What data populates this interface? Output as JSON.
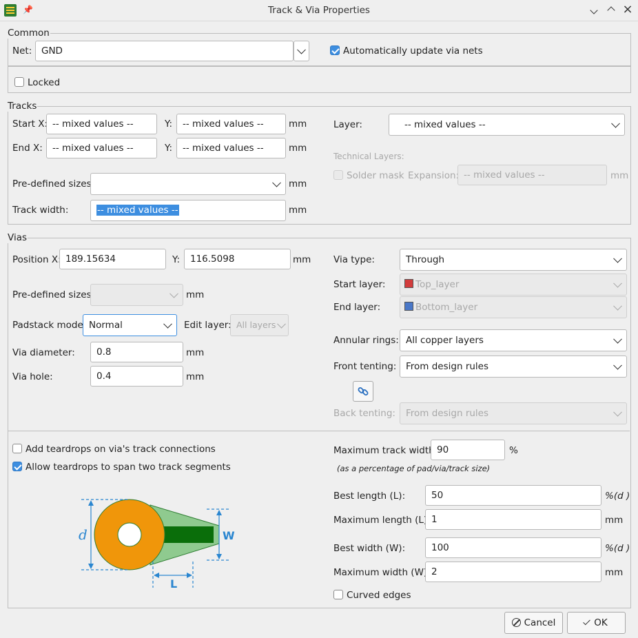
{
  "window": {
    "title": "Track & Via Properties"
  },
  "common": {
    "label": "Common",
    "net_label": "Net:",
    "net_value": "GND",
    "auto_update_label": "Automatically update via nets",
    "locked_label": "Locked"
  },
  "tracks": {
    "label": "Tracks",
    "start_x_label": "Start X:",
    "start_x_value": "-- mixed values --",
    "start_y_label": "Y:",
    "start_y_value": "-- mixed values --",
    "end_x_label": "End X:",
    "end_x_value": "-- mixed values --",
    "end_y_label": "Y:",
    "end_y_value": "-- mixed values --",
    "unit": "mm",
    "layer_label": "Layer:",
    "layer_value": "-- mixed values --",
    "technical_layers_label": "Technical Layers:",
    "solder_mask_label": "Solder mask",
    "expansion_label": "Expansion:",
    "expansion_value": "-- mixed values --",
    "predefined_label": "Pre-defined sizes:",
    "predefined_value": "",
    "track_width_label": "Track width:",
    "track_width_value": "-- mixed values --"
  },
  "vias": {
    "label": "Vias",
    "pos_x_label": "Position X:",
    "pos_x_value": "189.15634",
    "pos_y_label": "Y:",
    "pos_y_value": "116.5098",
    "unit": "mm",
    "predefined_label": "Pre-defined sizes:",
    "padstack_label": "Padstack mode:",
    "padstack_value": "Normal",
    "edit_layer_label": "Edit layer:",
    "edit_layer_value": "All layers",
    "diameter_label": "Via diameter:",
    "diameter_value": "0.8",
    "hole_label": "Via hole:",
    "hole_value": "0.4",
    "via_type_label": "Via type:",
    "via_type_value": "Through",
    "start_layer_label": "Start layer:",
    "start_layer_value": "Top_layer",
    "end_layer_label": "End layer:",
    "end_layer_value": "Bottom_layer",
    "annular_label": "Annular rings:",
    "annular_value": "All copper layers",
    "front_tenting_label": "Front tenting:",
    "front_tenting_value": "From design rules",
    "back_tenting_label": "Back tenting:",
    "back_tenting_value": "From design rules"
  },
  "teardrops": {
    "add_label": "Add teardrops on via's track connections",
    "span_label": "Allow teardrops to span two track segments",
    "max_track_width_label": "Maximum track width:",
    "max_track_width_value": "90",
    "percent": "%",
    "note": "(as a percentage of pad/via/track size)",
    "best_length_label": "Best length (L):",
    "best_length_value": "50",
    "pct_d": "%(d )",
    "max_length_label": "Maximum length (L):",
    "max_length_value": "1",
    "best_width_label": "Best width (W):",
    "best_width_value": "100",
    "max_width_label": "Maximum width (W):",
    "max_width_value": "2",
    "unit": "mm",
    "curved_label": "Curved edges",
    "diagram": {
      "d": "d",
      "w": "W",
      "l": "L"
    }
  },
  "buttons": {
    "cancel": "Cancel",
    "ok": "OK"
  },
  "colors": {
    "accent": "#3d8ee0",
    "top_layer": "#d23c3c",
    "bottom_layer": "#4a78c8",
    "pad": "#f0960a",
    "track": "#0a6e0a",
    "dimension": "#2a86d0"
  }
}
